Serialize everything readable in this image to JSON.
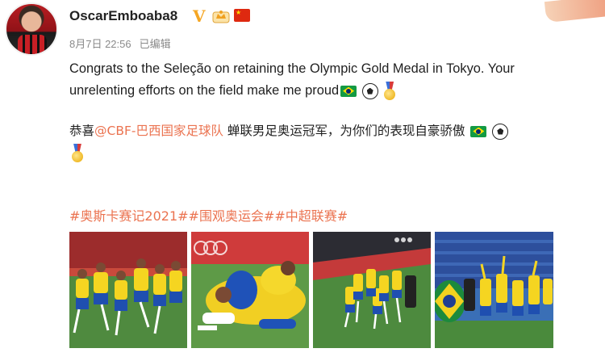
{
  "post": {
    "username": "OscarEmboaba8",
    "verified_badge": "V",
    "date": "8月7日 22:56",
    "edited_label": "已编辑",
    "text_en_1": "Congrats to the Seleção on retaining the Olympic Gold Medal in Tokyo. Your",
    "text_en_2": "unrelenting efforts on the field make me proud",
    "text_zh_prefix": "恭喜",
    "mention": "@CBF-巴西国家足球队",
    "text_zh_suffix": " 蝉联男足奥运冠军，为你们的表现自豪骄傲",
    "hashtags": "#奥斯卡赛记2021##围观奥运会##中超联赛#",
    "icons": [
      "brazil-flag-icon",
      "soccer-ball-icon",
      "gold-medal-icon",
      "china-flag-icon",
      "crown-badge-icon"
    ],
    "photos": [
      "photo-1",
      "photo-2",
      "photo-3",
      "photo-4"
    ],
    "accent_color": "#eb7350"
  }
}
